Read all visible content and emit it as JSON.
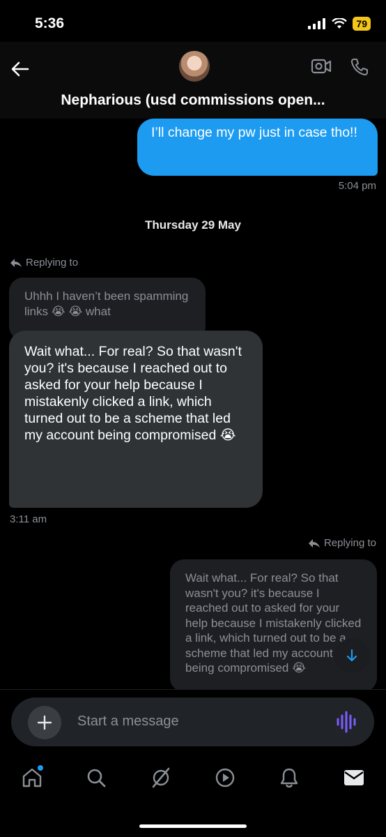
{
  "status": {
    "time": "5:36",
    "battery": "79"
  },
  "header": {
    "title": "Nepharious (usd commissions open..."
  },
  "messages": {
    "sent1": {
      "text": "I’ll change my pw just in case tho!!",
      "time": "5:04 pm"
    },
    "date_divider": "Thursday 29 May",
    "reply1": {
      "label": "Replying to",
      "quoted": "Uhhh I haven’t been spamming links 😭 😭  what",
      "text": "Wait what... For real? So that wasn't you? it's because I reached out to asked for your help because I mistakenly clicked a link, which turned out to be a scheme that led my account being compromised 😭",
      "time": "3:11 am"
    },
    "reply2": {
      "label": "Replying to",
      "quoted": "Wait what... For real? So that wasn't you? it's because I reached out to asked for your help because I mistakenly clicked a link, which turned out to be a scheme that led my account being compromised 😭"
    }
  },
  "composer": {
    "placeholder": "Start a message"
  },
  "colors": {
    "accent": "#1d9bf0",
    "voice": "#7c5cff",
    "battery": "#f5c518"
  },
  "icons": [
    "back-arrow-icon",
    "video-call-icon",
    "phone-icon",
    "reply-arrow-icon",
    "scroll-down-icon",
    "plus-icon",
    "voice-icon",
    "home-icon",
    "search-icon",
    "grok-icon",
    "video-icon",
    "notifications-icon",
    "messages-icon"
  ]
}
